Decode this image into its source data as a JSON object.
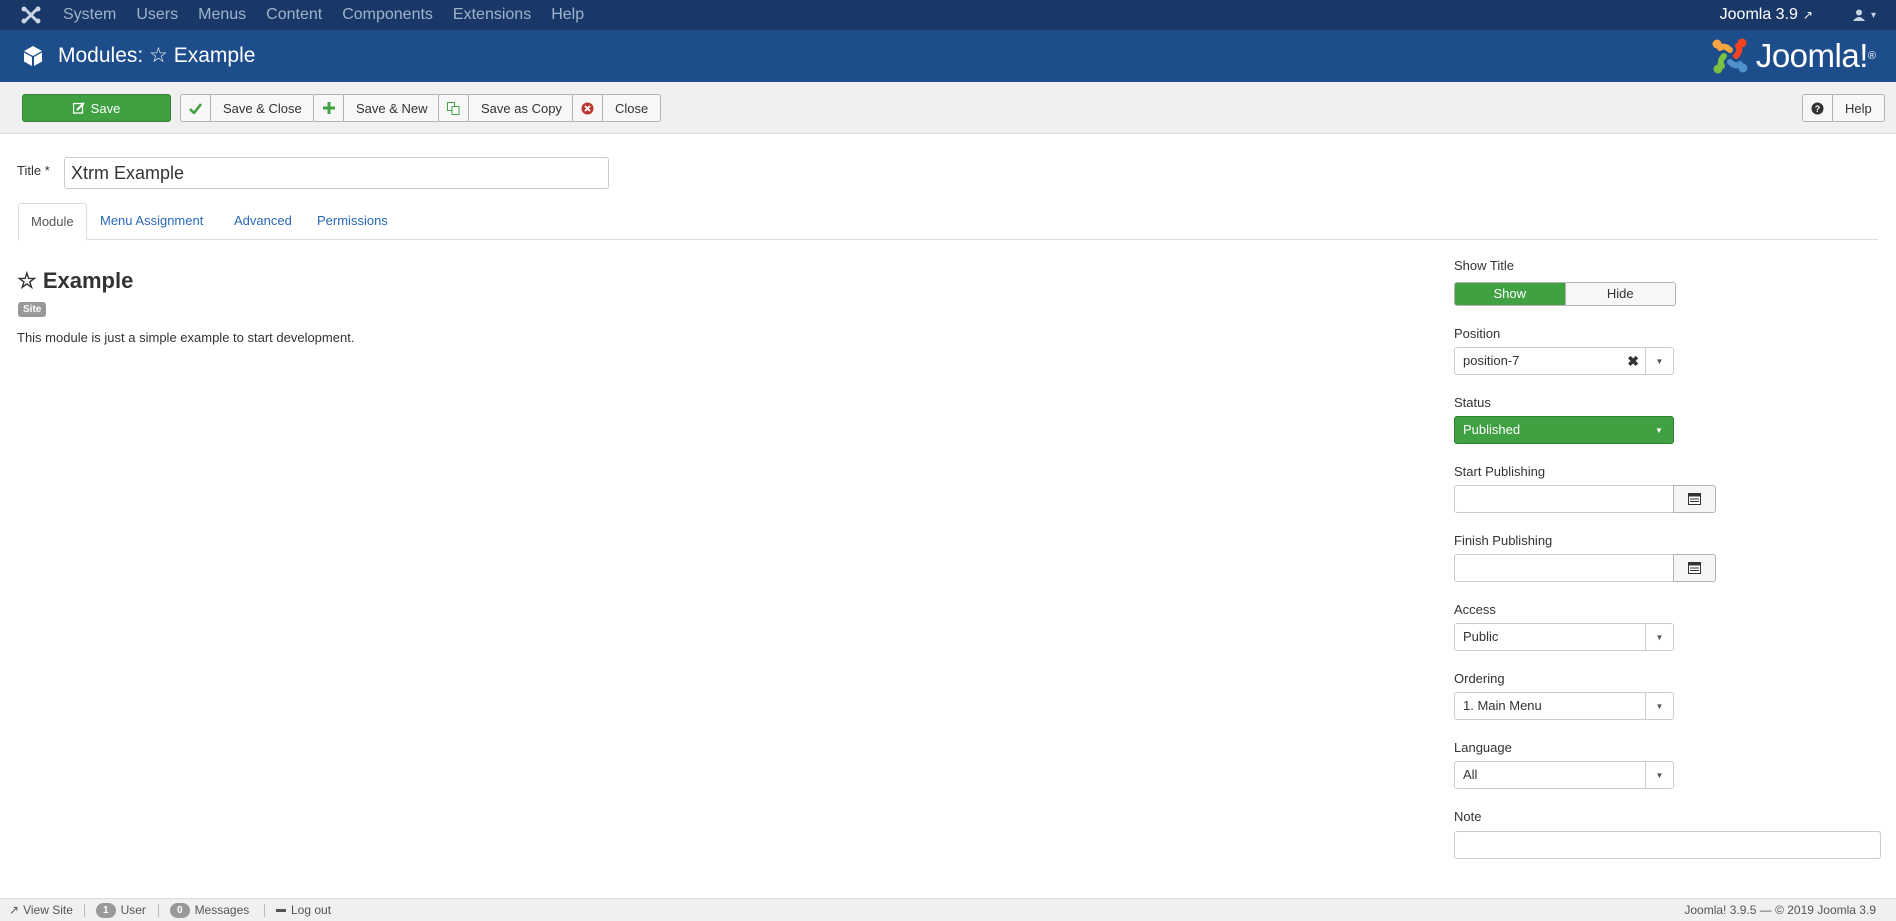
{
  "navbar": {
    "menu": [
      "System",
      "Users",
      "Menus",
      "Content",
      "Components",
      "Extensions",
      "Help"
    ],
    "site_link": "Joomla 3.9"
  },
  "header": {
    "title": "Modules: ☆ Example",
    "logo_text": "Joomla!",
    "logo_reg": "®"
  },
  "toolbar": {
    "save": "Save",
    "save_close": "Save & Close",
    "save_new": "Save & New",
    "save_copy": "Save as Copy",
    "close": "Close",
    "help": "Help"
  },
  "form": {
    "title_label": "Title *",
    "title_value": "Xtrm Example",
    "tabs": [
      "Module",
      "Menu Assignment",
      "Advanced",
      "Permissions"
    ],
    "active_tab": "Module"
  },
  "module": {
    "heading": "☆ Example",
    "badge": "Site",
    "description": "This module is just a simple example to start development."
  },
  "options": {
    "show_title_label": "Show Title",
    "show_label": "Show",
    "hide_label": "Hide",
    "show_title_selected": "Show",
    "position_label": "Position",
    "position_value": "position-7",
    "status_label": "Status",
    "status_value": "Published",
    "start_publishing_label": "Start Publishing",
    "start_publishing_value": "",
    "finish_publishing_label": "Finish Publishing",
    "finish_publishing_value": "",
    "access_label": "Access",
    "access_value": "Public",
    "ordering_label": "Ordering",
    "ordering_value": "1. Main Menu",
    "language_label": "Language",
    "language_value": "All",
    "note_label": "Note",
    "note_value": ""
  },
  "statusbar": {
    "view_site": "View Site",
    "user_count": "1",
    "user_label": "User",
    "messages_count": "0",
    "messages_label": "Messages",
    "logout": "Log out",
    "footer": "Joomla! 3.9.5  —  © 2019 Joomla 3.9"
  },
  "colors": {
    "navbar": "#1a3867",
    "header": "#1d4d8b",
    "success": "#3fa142",
    "link": "#2a69b8"
  },
  "icons": {
    "navbar": [
      "joomla-icon",
      "external-link-icon",
      "user-icon",
      "caret-down-icon"
    ],
    "header": [
      "cube-icon",
      "joomla-logo"
    ],
    "toolbar": [
      "edit-icon",
      "check-icon",
      "plus-icon",
      "copy-icon",
      "cancel-circle-icon",
      "question-icon"
    ],
    "form": [
      "clear-icon",
      "caret-down-icon",
      "calendar-icon"
    ],
    "statusbar": [
      "external-link-icon",
      "minus-icon"
    ]
  }
}
